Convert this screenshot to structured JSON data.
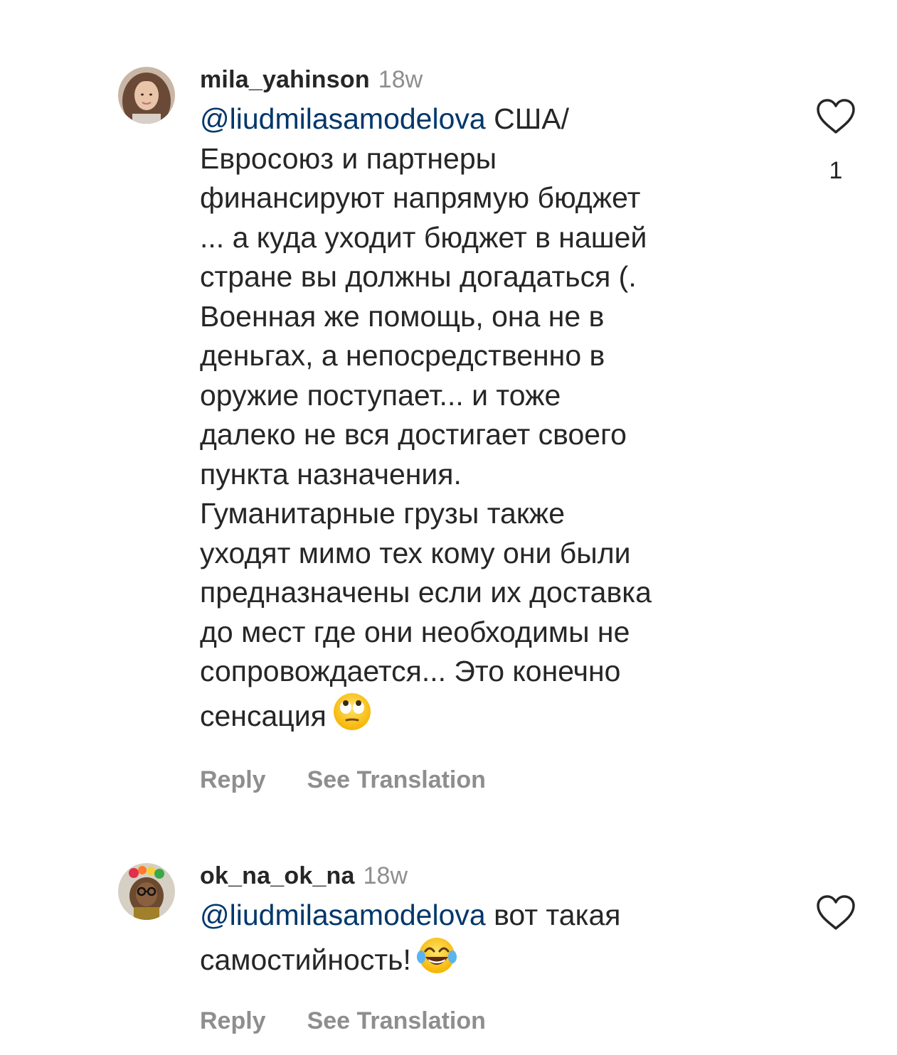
{
  "comments": [
    {
      "username": "mila_yahinson",
      "time": "18w",
      "mention": "@liudmilasamodelova",
      "text": " США/\nЕвросоюз и партнеры\nфинансируют напрямую бюджет\n... а куда уходит бюджет в нашей\nстране вы должны догадаться (.\nВоенная же помощь, она не в\nденьгах, а непосредственно в\nоружие поступает... и тоже\nдалеко не вся достигает своего\nпункта назначения.\nГуманитарные грузы также\nуходят мимо тех кому они были\nпредназначены если их доставка\nдо мест где они необходимы не\nсопровождается... Это конечно\nсенсация",
      "emoji": "eye-roll-emoji",
      "reply_label": "Reply",
      "translate_label": "See Translation",
      "like_count": "1",
      "like_icon": "heart-outline-icon"
    },
    {
      "username": "ok_na_ok_na",
      "time": "18w",
      "mention": "@liudmilasamodelova",
      "text": " вот такая\nсамостийность!",
      "emoji": "tears-of-joy-emoji",
      "reply_label": "Reply",
      "translate_label": "See Translation",
      "like_count": "",
      "like_icon": "heart-outline-icon"
    }
  ],
  "colors": {
    "text": "#262626",
    "secondary": "#8e8e8e",
    "mention": "#00376b"
  }
}
